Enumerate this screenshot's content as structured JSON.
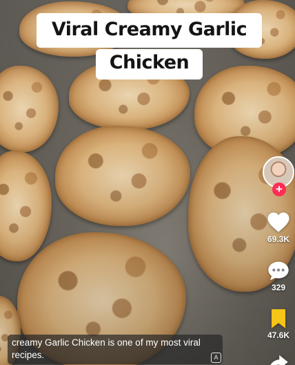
{
  "video": {
    "title_line1": "Viral Creamy Garlic",
    "title_line2": "Chicken",
    "caption": "creamy Garlic Chicken is one of my most viral recipes."
  },
  "actions": {
    "likes": "69.3K",
    "comments": "329",
    "saves": "47.6K",
    "follow_symbol": "+"
  },
  "colors": {
    "follow_accent": "#fe2c55",
    "save_accent": "#f5c518"
  },
  "icons": [
    "avatar",
    "heart-icon",
    "comment-icon",
    "bookmark-icon",
    "share-icon",
    "translate-icon"
  ]
}
